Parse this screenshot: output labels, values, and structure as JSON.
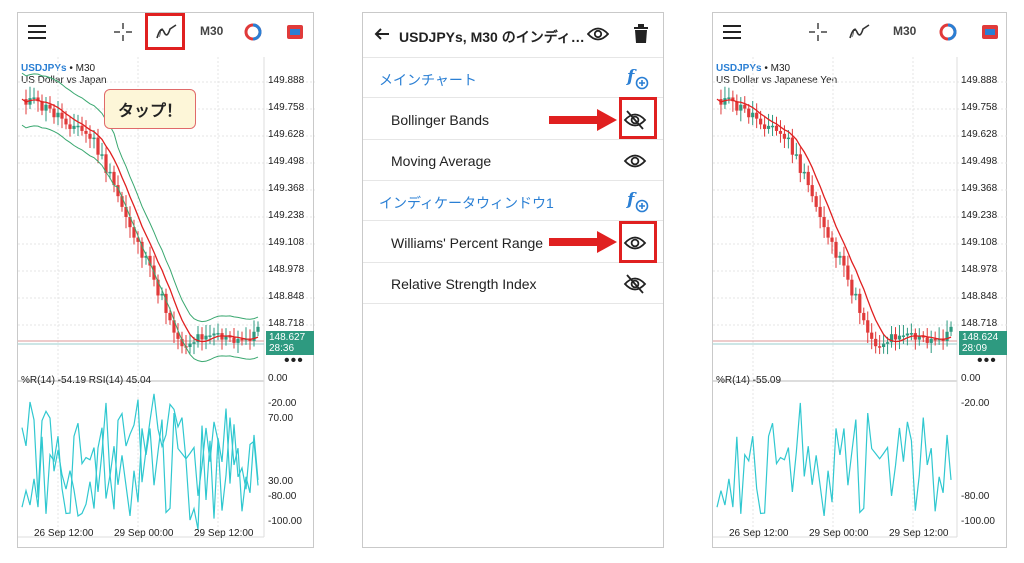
{
  "panel1": {
    "toolbar": {
      "menu_icon": "menu-icon",
      "crosshair_icon": "crosshair-icon",
      "indicator_icon": "indicator-icon",
      "timeframe": "M30",
      "color_icon": "color-icon",
      "tag_icon": "tag-icon"
    },
    "chart": {
      "symbol": "USDJPYs",
      "timeframe": "• M30",
      "description": "US Dollar vs Japanese Yen",
      "price_ticks": [
        "149.888",
        "149.758",
        "149.628",
        "149.498",
        "149.368",
        "149.238",
        "149.108",
        "148.978",
        "148.848",
        "148.718"
      ],
      "current_price": "148.627",
      "countdown": "28:36",
      "more": "•••",
      "indicator_label": "%R(14) -54.19 RSI(14) 45.04",
      "osc_ticks": [
        "0.00",
        "-20.00",
        "70.00",
        "30.00",
        "-80.00",
        "-100.00"
      ],
      "time_ticks": [
        "26 Sep 12:00",
        "29 Sep 00:00",
        "29 Sep 12:00"
      ]
    },
    "callout": "タップ！"
  },
  "panel2": {
    "header": {
      "back_icon": "back-arrow-icon",
      "title": "USDJPYs, M30 のインディ…",
      "eye_icon": "eye-icon",
      "trash_icon": "trash-icon"
    },
    "sections": [
      {
        "title": "メインチャート",
        "add_icon": "add-function-icon",
        "items": [
          {
            "label": "Bollinger Bands",
            "visibility": "hidden"
          },
          {
            "label": "Moving Average",
            "visibility": "visible"
          }
        ]
      },
      {
        "title": "インディケータウィンドウ1",
        "add_icon": "add-function-icon",
        "items": [
          {
            "label": "Williams' Percent Range",
            "visibility": "visible"
          },
          {
            "label": "Relative Strength Index",
            "visibility": "hidden"
          }
        ]
      }
    ]
  },
  "panel3": {
    "toolbar": {
      "menu_icon": "menu-icon",
      "crosshair_icon": "crosshair-icon",
      "indicator_icon": "indicator-icon",
      "timeframe": "M30",
      "color_icon": "color-icon",
      "tag_icon": "tag-icon"
    },
    "chart": {
      "symbol": "USDJPYs",
      "timeframe": "• M30",
      "description": "US Dollar vs Japanese Yen",
      "price_ticks": [
        "149.888",
        "149.758",
        "149.628",
        "149.498",
        "149.368",
        "149.238",
        "149.108",
        "148.978",
        "148.848",
        "148.718"
      ],
      "current_price": "148.624",
      "countdown": "28:09",
      "more": "•••",
      "indicator_label": "%R(14) -55.09",
      "osc_ticks": [
        "0.00",
        "-20.00",
        "-80.00",
        "-100.00"
      ],
      "time_ticks": [
        "26 Sep 12:00",
        "29 Sep 00:00",
        "29 Sep 12:00"
      ]
    }
  },
  "colors": {
    "accent": "#2a7fd4",
    "bull": "#2e9a80",
    "bear": "#e03a3a",
    "ma": "#e02020",
    "bb": "#3aa870",
    "wpr": "#30c8d0",
    "rsi": "#30c8d0",
    "highlight": "#e02020"
  },
  "chart_data": [
    {
      "type": "candlestick",
      "panel": "left",
      "series": [
        {
          "name": "USDJPYs M30"
        }
      ],
      "ylim": [
        148.62,
        149.95
      ],
      "indicators": [
        "Bollinger Bands",
        "Moving Average"
      ],
      "oscillators": [
        "%R(14)",
        "RSI(14)"
      ],
      "osc_values": {
        "%R(14)": -54.19,
        "RSI(14)": 45.04
      }
    },
    {
      "type": "candlestick",
      "panel": "right",
      "series": [
        {
          "name": "USDJPYs M30"
        }
      ],
      "ylim": [
        148.62,
        149.95
      ],
      "indicators": [
        "Moving Average"
      ],
      "oscillators": [
        "%R(14)"
      ],
      "osc_values": {
        "%R(14)": -55.09
      }
    }
  ]
}
